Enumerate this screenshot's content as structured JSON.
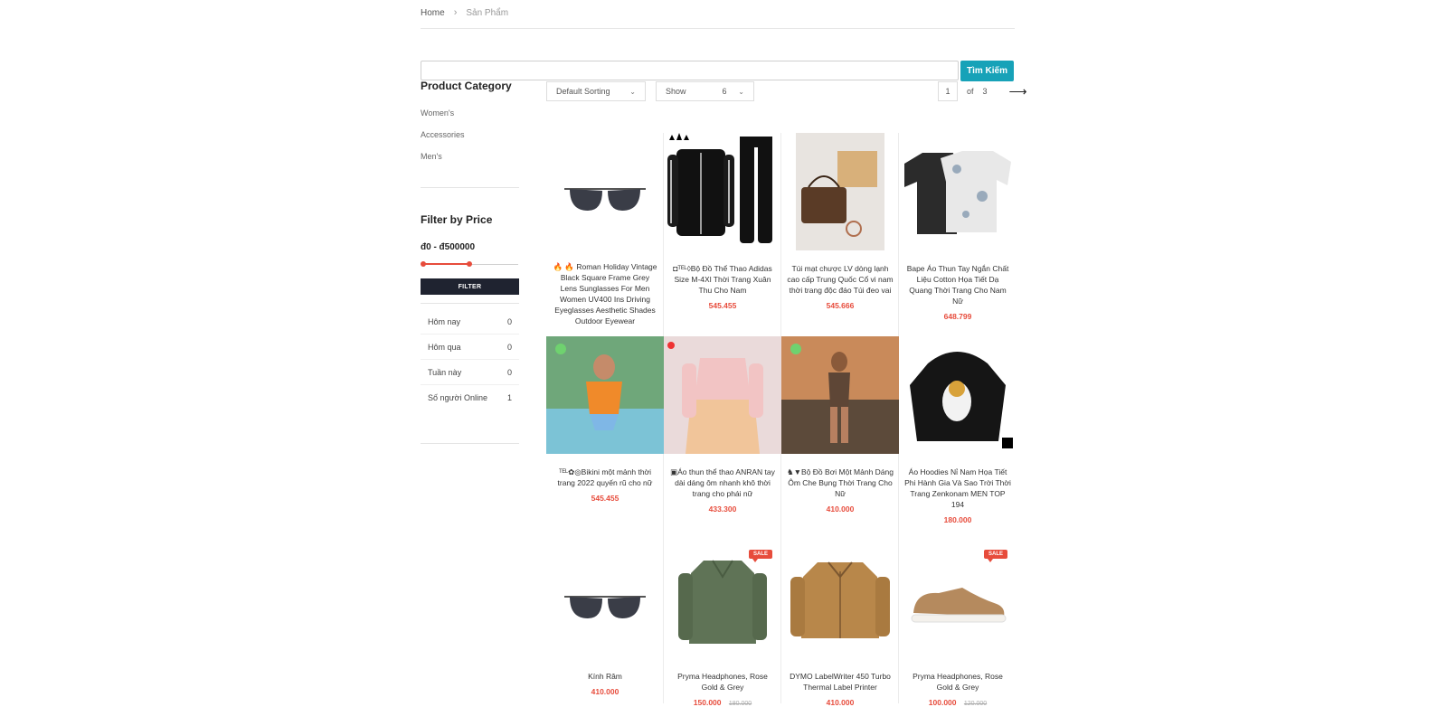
{
  "breadcrumb": {
    "home": "Home",
    "current": "Sản Phẩm"
  },
  "search": {
    "placeholder": "",
    "button": "Tìm Kiếm"
  },
  "sidebar": {
    "category_title": "Product Category",
    "categories": [
      "Women's",
      "Accessories",
      "Men's"
    ],
    "filter_title": "Filter by Price",
    "price_range": "đ0 - đ500000",
    "filter_button": "FILTER",
    "stats": [
      {
        "label": "Hôm nay",
        "value": "0"
      },
      {
        "label": "Hôm qua",
        "value": "0"
      },
      {
        "label": "Tuần này",
        "value": "0"
      },
      {
        "label": "Số người Online",
        "value": "1"
      }
    ]
  },
  "toolbar": {
    "sorting": "Default Sorting",
    "show_label": "Show",
    "show_value": "6",
    "page_current": "1",
    "page_of": "of",
    "page_total": "3"
  },
  "products": [
    {
      "name": "🔥 🔥 Roman Holiday Vintage Black Square Frame Grey Lens Sunglasses For Men Women UV400 Ins Driving Eyeglasses Aesthetic Shades Outdoor Eyewear",
      "price": "",
      "image": "sunglasses-icon"
    },
    {
      "name": "◘ᵀᴱᴸ◊Bộ Đồ Thể Thao Adidas Size M-4Xl Thời Trang Xuân Thu Cho Nam",
      "price": "545.455",
      "image": "tracksuit-icon"
    },
    {
      "name": "Túi mạt chược LV dòng lạnh cao cấp Trung Quốc Cổ vi nam thời trang độc đáo Túi đeo vai",
      "price": "545.666",
      "image": "handbag-icon"
    },
    {
      "name": "Bape Áo Thun Tay Ngắn Chất Liệu Cotton Họa Tiết Dạ Quang Thời Trang Cho Nam Nữ",
      "price": "648.799",
      "image": "tshirt-icon"
    },
    {
      "name": "ᵀᴱᴸ✿◎Bikini một mảnh thời trang 2022 quyến rũ cho nữ",
      "price": "545.455",
      "image": "swimsuit-photo"
    },
    {
      "name": "▣Áo thun thể thao ANRAN tay dài dáng ôm nhanh khô thời trang cho phái nữ",
      "price": "433.300",
      "image": "sport-top-photo"
    },
    {
      "name": "♞▼Bộ Đồ Bơi Một Mảnh Dáng Ôm Che Bụng Thời Trang Cho Nữ",
      "price": "410.000",
      "image": "swimwear-sunset-photo"
    },
    {
      "name": "Áo Hoodies Nỉ Nam Họa Tiết Phi Hành Gia Và Sao Trời Thời Trang Zenkonam MEN TOP 194",
      "price": "180.000",
      "image": "hoodie-icon"
    },
    {
      "name": "Kính Râm",
      "price": "410.000",
      "image": "sunglasses-icon"
    },
    {
      "name": "Pryma Headphones, Rose Gold & Grey",
      "price": "150.000",
      "old_price": "180.000",
      "sale": "SALE",
      "image": "green-sweater-icon"
    },
    {
      "name": "DYMO LabelWriter 450 Turbo Thermal Label Printer",
      "price": "410.000",
      "image": "tan-jacket-icon"
    },
    {
      "name": "Pryma Headphones, Rose Gold & Grey",
      "price": "100.000",
      "old_price": "120.000",
      "sale": "SALE",
      "image": "sneaker-icon"
    }
  ]
}
